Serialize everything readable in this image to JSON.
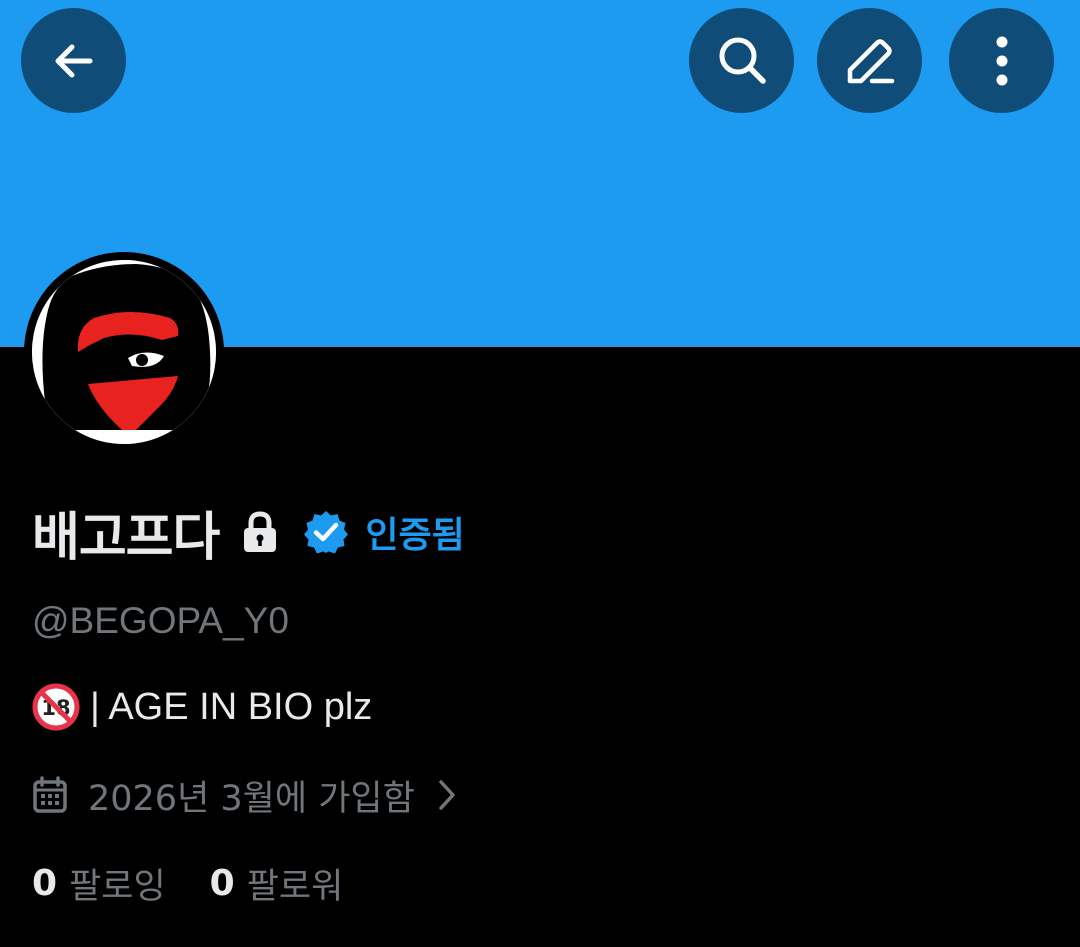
{
  "profile": {
    "display_name": "배고프다",
    "verified_label": "인증됨",
    "handle": "@BEGOPA_Y0",
    "bio": "| AGE IN BIO plz",
    "joined": "2026년 3월에 가입함",
    "following_count": "0",
    "following_label": "팔로잉",
    "followers_count": "0",
    "followers_label": "팔로워"
  },
  "icons": {
    "back": "arrow-left-icon",
    "search": "search-icon",
    "edit": "pencil-icon",
    "more": "more-vertical-icon",
    "lock": "lock-icon",
    "verified": "verified-badge-icon",
    "age": "no-under-18-icon",
    "calendar": "calendar-icon",
    "chevron": "chevron-right-icon"
  },
  "colors": {
    "banner": "#1d9bf0",
    "button_bg": "#0f4c78",
    "accent": "#1d9bf0",
    "text_primary": "#e7e9ea",
    "text_secondary": "#71767b",
    "background": "#000000"
  }
}
